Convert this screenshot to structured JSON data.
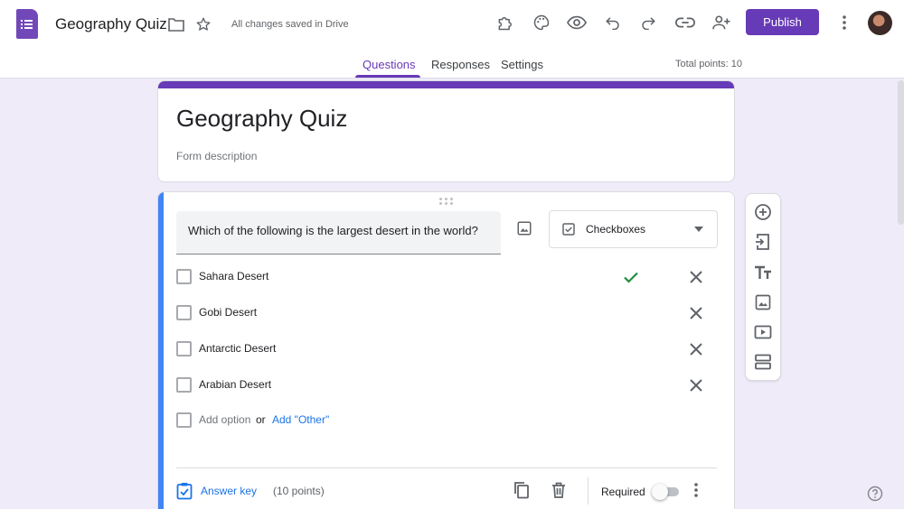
{
  "header": {
    "doc_title": "Geography Quiz",
    "save_status": "All changes saved in Drive",
    "publish_label": "Publish",
    "icons": [
      "forms-logo-icon",
      "folder-icon",
      "star-icon",
      "addons-icon",
      "palette-icon",
      "preview-eye-icon",
      "undo-icon",
      "redo-icon",
      "link-icon",
      "add-collaborator-icon",
      "more-vert-icon"
    ]
  },
  "tabs": [
    {
      "label": "Questions",
      "active": true
    },
    {
      "label": "Responses",
      "active": false
    },
    {
      "label": "Settings",
      "active": false
    }
  ],
  "total_points": "Total points: 10",
  "form": {
    "title": "Geography Quiz",
    "description_placeholder": "Form description"
  },
  "question": {
    "text": "Which of the following is the largest desert in the world?",
    "type": "Checkboxes",
    "options": [
      {
        "label": "Sahara Desert",
        "correct": true
      },
      {
        "label": "Gobi Desert",
        "correct": false
      },
      {
        "label": "Antarctic Desert",
        "correct": false
      },
      {
        "label": "Arabian Desert",
        "correct": false
      }
    ],
    "add_option": "Add option",
    "or": "or",
    "add_other": "Add \"Other\"",
    "answer_key": "Answer key",
    "points": "(10 points)",
    "required_label": "Required",
    "required": false
  },
  "toolbar_icons": [
    "add-question-icon",
    "import-questions-icon",
    "add-title-icon",
    "add-image-icon",
    "add-video-icon",
    "add-section-icon"
  ],
  "colors": {
    "accent": "#673ab7",
    "background": "#f0ebf8",
    "active_question": "#4285f4",
    "link": "#1a73e8",
    "correct": "#1e8e3e"
  }
}
